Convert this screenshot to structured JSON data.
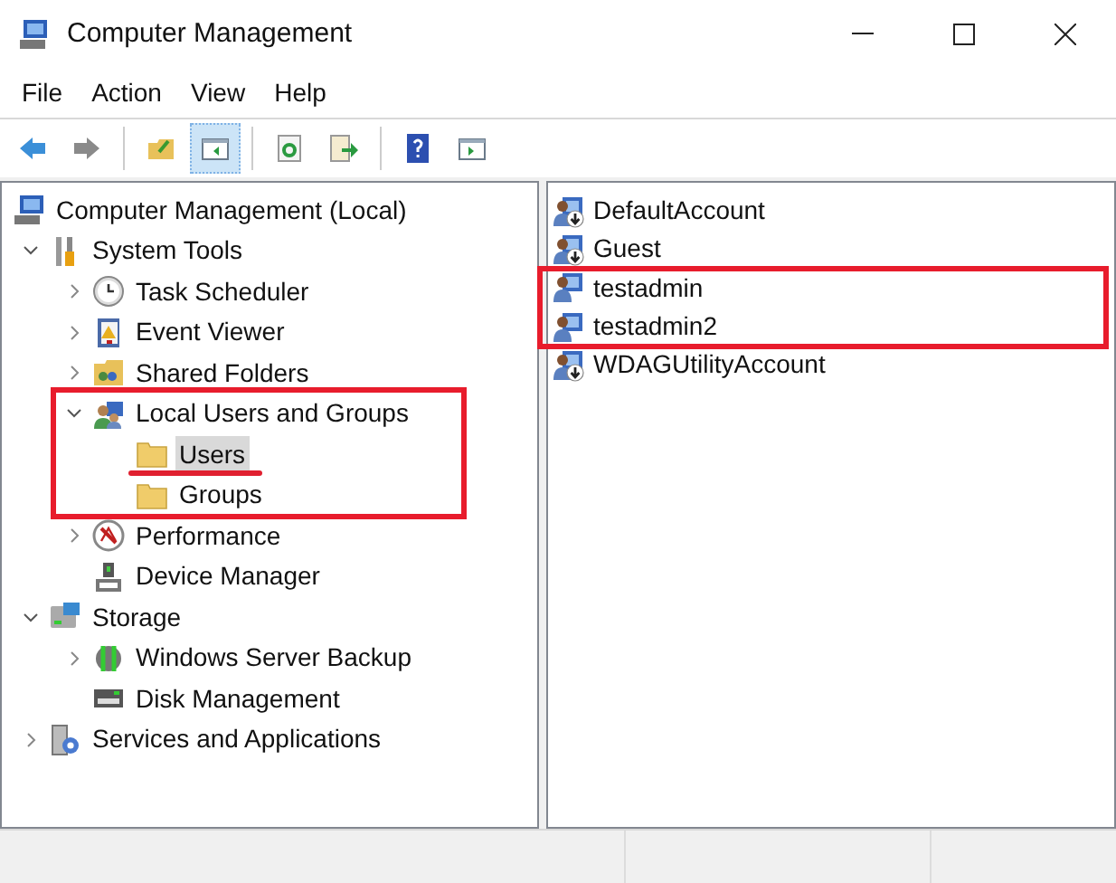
{
  "window": {
    "title": "Computer Management"
  },
  "menu": [
    "File",
    "Action",
    "View",
    "Help"
  ],
  "toolbar": [
    {
      "kind": "back",
      "active": false
    },
    {
      "kind": "forward",
      "active": false
    },
    {
      "kind": "separator"
    },
    {
      "kind": "up",
      "active": false
    },
    {
      "kind": "tree",
      "active": true
    },
    {
      "kind": "separator"
    },
    {
      "kind": "refresh",
      "active": false
    },
    {
      "kind": "export",
      "active": false
    },
    {
      "kind": "separator"
    },
    {
      "kind": "help",
      "active": false
    },
    {
      "kind": "pane",
      "active": false
    }
  ],
  "tree": [
    {
      "label": "Computer Management (Local)",
      "kind": "computer",
      "selected": false,
      "children": [
        {
          "label": "System Tools",
          "kind": "tools",
          "expanded": true,
          "selected": false,
          "children": [
            {
              "label": "Task Scheduler",
              "kind": "clock",
              "expanded": false,
              "selected": false
            },
            {
              "label": "Event Viewer",
              "kind": "log",
              "expanded": false,
              "selected": false
            },
            {
              "label": "Shared Folders",
              "kind": "share",
              "expanded": false,
              "selected": false
            },
            {
              "label": "Local Users and Groups",
              "kind": "users",
              "expanded": true,
              "selected": false,
              "marked": true,
              "children": [
                {
                  "label": "Users",
                  "kind": "folder",
                  "selected": true,
                  "underlined": true
                },
                {
                  "label": "Groups",
                  "kind": "folder",
                  "selected": false
                }
              ]
            },
            {
              "label": "Performance",
              "kind": "performance",
              "expanded": false,
              "selected": false
            },
            {
              "label": "Device Manager",
              "kind": "device",
              "selected": false
            }
          ]
        },
        {
          "label": "Storage",
          "kind": "storage",
          "expanded": true,
          "selected": false,
          "children": [
            {
              "label": "Windows Server Backup",
              "kind": "backup",
              "expanded": false,
              "selected": false
            },
            {
              "label": "Disk Management",
              "kind": "disk",
              "selected": false
            }
          ]
        },
        {
          "label": "Services and Applications",
          "kind": "services",
          "expanded": false,
          "selected": false
        }
      ]
    }
  ],
  "users": [
    {
      "name": "DefaultAccount",
      "disabled": true
    },
    {
      "name": "Guest",
      "disabled": true
    },
    {
      "name": "testadmin",
      "disabled": false,
      "marked": true
    },
    {
      "name": "testadmin2",
      "disabled": false,
      "marked": true
    },
    {
      "name": "WDAGUtilityAccount",
      "disabled": true
    }
  ]
}
